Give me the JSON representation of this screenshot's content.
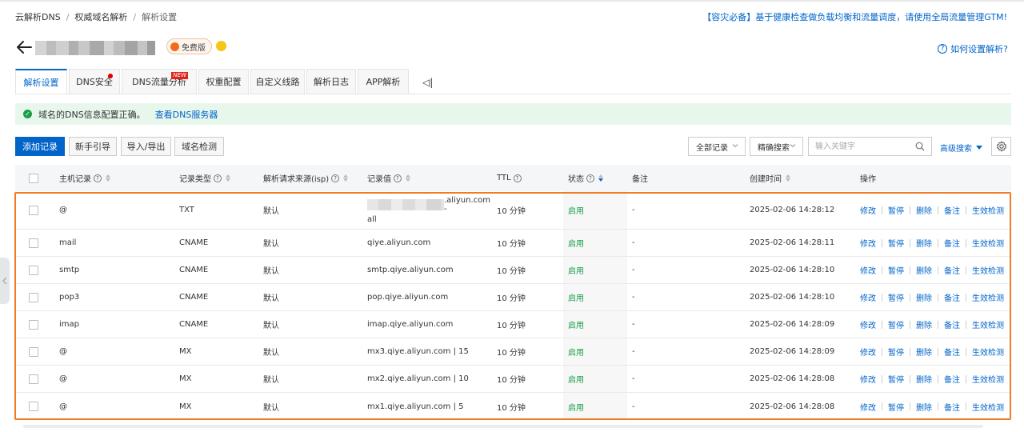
{
  "breadcrumb": [
    "云解析DNS",
    "权威域名解析",
    "解析设置"
  ],
  "notice": "【容灾必备】基于健康检查做负载均衡和流量调度，请使用全局流量管理GTM!",
  "title": {
    "badge": "免费版",
    "help": "如何设置解析?"
  },
  "tabs": [
    {
      "label": "解析设置",
      "active": true
    },
    {
      "label": "DNS安全",
      "dot": true
    },
    {
      "label": "DNS流量分析",
      "new": "NEW"
    },
    {
      "label": "权重配置"
    },
    {
      "label": "自定义线路"
    },
    {
      "label": "解析日志"
    },
    {
      "label": "APP解析"
    }
  ],
  "tab_collapse": "◁|",
  "alert": {
    "text": "域名的DNS信息配置正确。",
    "link": "查看DNS服务器"
  },
  "toolbar": {
    "add": "添加记录",
    "guide": "新手引导",
    "import_export": "导入/导出",
    "check": "域名检测",
    "filter_all": "全部记录",
    "match": "精确搜索",
    "search_placeholder": "输入关键字",
    "advanced": "高级搜索"
  },
  "table": {
    "columns": {
      "host": "主机记录",
      "type": "记录类型",
      "line": "解析请求来源(isp)",
      "value": "记录值",
      "ttl": "TTL",
      "status": "状态",
      "remark": "备注",
      "created": "创建时间",
      "ops": "操作"
    },
    "ops": [
      "修改",
      "暂停",
      "删除",
      "备注",
      "生效检测"
    ],
    "rows": [
      {
        "host": "@",
        "type": "TXT",
        "line": "默认",
        "value_suffix": ".aliyun.com -",
        "value_line2": "all",
        "ttl": "10 分钟",
        "status": "启用",
        "remark": "-",
        "created": "2025-02-06 14:28:12"
      },
      {
        "host": "mail",
        "type": "CNAME",
        "line": "默认",
        "value": "qiye.aliyun.com",
        "ttl": "10 分钟",
        "status": "启用",
        "remark": "-",
        "created": "2025-02-06 14:28:11"
      },
      {
        "host": "smtp",
        "type": "CNAME",
        "line": "默认",
        "value": "smtp.qiye.aliyun.com",
        "ttl": "10 分钟",
        "status": "启用",
        "remark": "-",
        "created": "2025-02-06 14:28:10"
      },
      {
        "host": "pop3",
        "type": "CNAME",
        "line": "默认",
        "value": "pop.qiye.aliyun.com",
        "ttl": "10 分钟",
        "status": "启用",
        "remark": "-",
        "created": "2025-02-06 14:28:10"
      },
      {
        "host": "imap",
        "type": "CNAME",
        "line": "默认",
        "value": "imap.qiye.aliyun.com",
        "ttl": "10 分钟",
        "status": "启用",
        "remark": "-",
        "created": "2025-02-06 14:28:09"
      },
      {
        "host": "@",
        "type": "MX",
        "line": "默认",
        "value": "mx3.qiye.aliyun.com | 15",
        "ttl": "10 分钟",
        "status": "启用",
        "remark": "-",
        "created": "2025-02-06 14:28:09"
      },
      {
        "host": "@",
        "type": "MX",
        "line": "默认",
        "value": "mx2.qiye.aliyun.com | 10",
        "ttl": "10 分钟",
        "status": "启用",
        "remark": "-",
        "created": "2025-02-06 14:28:08"
      },
      {
        "host": "@",
        "type": "MX",
        "line": "默认",
        "value": "mx1.qiye.aliyun.com | 5",
        "ttl": "10 分钟",
        "status": "启用",
        "remark": "-",
        "created": "2025-02-06 14:28:08"
      }
    ]
  },
  "colors": {
    "primary": "#0064c8",
    "success": "#1a9e48",
    "highlight": "#ef7c24",
    "badge": "#f26b1d",
    "warning": "#f5c518"
  },
  "icons": [
    "back-arrow-icon",
    "help-circle-icon",
    "check-circle-icon",
    "chevron-down-icon",
    "search-icon",
    "gear-icon",
    "question-icon",
    "sort-icon",
    "chevron-left-icon"
  ]
}
